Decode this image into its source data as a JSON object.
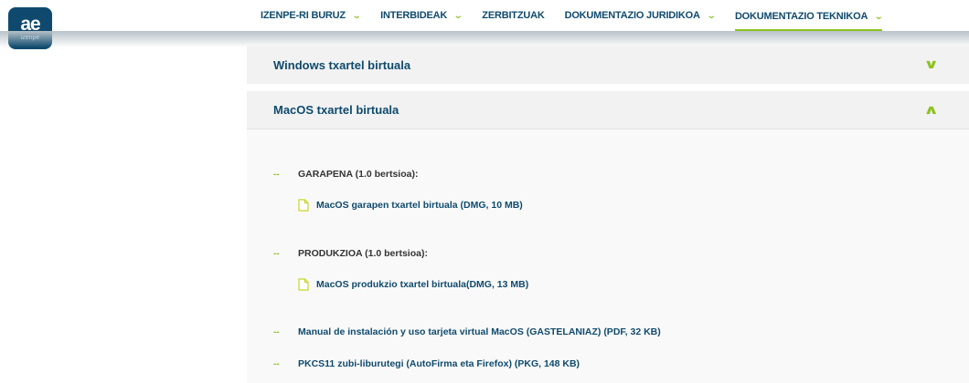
{
  "logo": {
    "main": "ae",
    "sub": "izenpe"
  },
  "nav": {
    "items": [
      {
        "label": "IZENPE-RI BURUZ",
        "has_dropdown": true,
        "active": false
      },
      {
        "label": "INTERBIDEAK",
        "has_dropdown": true,
        "active": false
      },
      {
        "label": "ZERBITZUAK",
        "has_dropdown": false,
        "active": false
      },
      {
        "label": "DOKUMENTAZIO JURIDIKOA",
        "has_dropdown": true,
        "active": false
      },
      {
        "label": "DOKUMENTAZIO TEKNIKOA",
        "has_dropdown": true,
        "active": true
      }
    ],
    "chevron": "⌄"
  },
  "accordion": {
    "windows": {
      "title": "Windows txartel birtuala",
      "toggle": "∨",
      "expanded": false
    },
    "macos": {
      "title": "MacOS txartel birtuala",
      "toggle": "∧",
      "expanded": true,
      "dash": "--",
      "sections": {
        "garapena": "GARAPENA (1.0 bertsioa):",
        "garapena_file": "MacOS garapen txartel birtuala (DMG, 10 MB)",
        "produkzioa": "PRODUKZIOA (1.0 bertsioa):",
        "produkzioa_file": "MacOS produkzio txartel birtuala(DMG, 13 MB)",
        "manual": "Manual de instalación y uso tarjeta virtual MacOS (GASTELANIAZ) (PDF, 32 KB)",
        "pkcs11": "PKCS11 zubi-liburutegi (AutoFirma eta Firefox) (PKG, 148 KB)"
      }
    }
  },
  "colors": {
    "brand": "#0f4a6e",
    "accent": "#8dc21f",
    "header_bg": "#f2f2f2"
  }
}
